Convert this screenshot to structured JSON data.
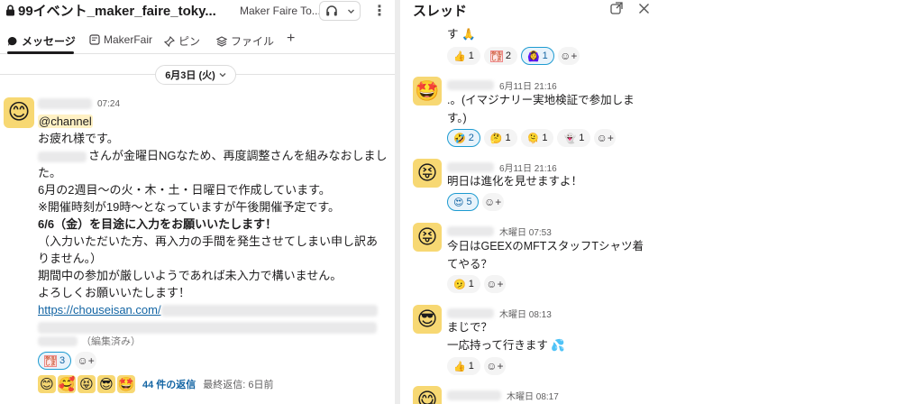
{
  "channel": {
    "title": "99イベント_maker_faire_toky...",
    "subtitle": "Maker Faire To...",
    "tabs": [
      {
        "label": "メッセージ"
      },
      {
        "label": "MakerFair"
      },
      {
        "label": "ピン"
      },
      {
        "label": "ファイル"
      },
      {
        "label": "+"
      }
    ],
    "date_pill": "6月3日 (火)"
  },
  "main_message": {
    "time": "07:24",
    "mention": "@channel",
    "lines": [
      "お疲れ様です。",
      "さんが金曜日NGなため、再度調整さんを組みなおしまし",
      "た。",
      "6月の2週目〜の火・木・土・日曜日で作成しています。",
      "※開催時刻が19時〜となっていますが午後開催予定です。",
      "6/6（金）を目途に入力をお願いいたします！",
      "（入力いただいた方、再入力の手間を発生させてしまい申し訳あ",
      "りません。）",
      "期間中の参加が厳しいようであれば未入力で構いません。",
      "よろしくお願いいたします！"
    ],
    "link": "https://chouseisan.com/",
    "edited": "（編集済み）",
    "reaction_count": "3",
    "replies": "44 件の返信",
    "last_reply": "最終返信: 6日前",
    "reaction_badge_text": "参加\nします"
  },
  "thread": {
    "title": "スレッド",
    "messages": [
      {
        "text_lines": [
          "す 🙏"
        ],
        "reactions": [
          {
            "emoji": "👍",
            "count": "1"
          },
          {
            "emoji": "参加",
            "count": "2"
          },
          {
            "emoji": "🙆‍♀️",
            "count": "1"
          }
        ]
      },
      {
        "avatar": "🤩",
        "time": "6月11日 21:16",
        "text_lines": [
          ".。(イマジナリー実地検証で参加しま",
          "す。)"
        ],
        "reactions": [
          {
            "emoji": "🤣",
            "count": "2"
          },
          {
            "emoji": "🤔",
            "count": "1"
          },
          {
            "emoji": "🫠",
            "count": "1"
          },
          {
            "emoji": "👻",
            "count": "1"
          }
        ]
      },
      {
        "avatar": "😝",
        "time": "6月11日 21:16",
        "text_lines": [
          "明日は進化を見せますよ！"
        ],
        "reactions": [
          {
            "emoji": "😍",
            "count": "5"
          }
        ]
      },
      {
        "avatar": "😝",
        "time": "木曜日 07:53",
        "text_lines": [
          "今日はGEEXのMFTスタッフTシャツ着",
          "てやる？"
        ],
        "reactions": [
          {
            "emoji": "🫤",
            "count": "1"
          }
        ]
      },
      {
        "avatar": "😎",
        "time": "木曜日 08:13",
        "text_lines": [
          "まじで？",
          "一応持って行きます 💦"
        ],
        "reactions": [
          {
            "emoji": "👍",
            "count": "1"
          }
        ]
      },
      {
        "avatar": "😋",
        "time": "木曜日 08:17",
        "text_lines": [],
        "reactions": []
      }
    ]
  },
  "icons": {
    "lock": "lock-icon",
    "headphones": "headphones-icon",
    "kebab": "more-vertical-icon",
    "new_window": "open-in-window-icon",
    "close": "close-icon",
    "add_reaction": "add-reaction-icon"
  }
}
